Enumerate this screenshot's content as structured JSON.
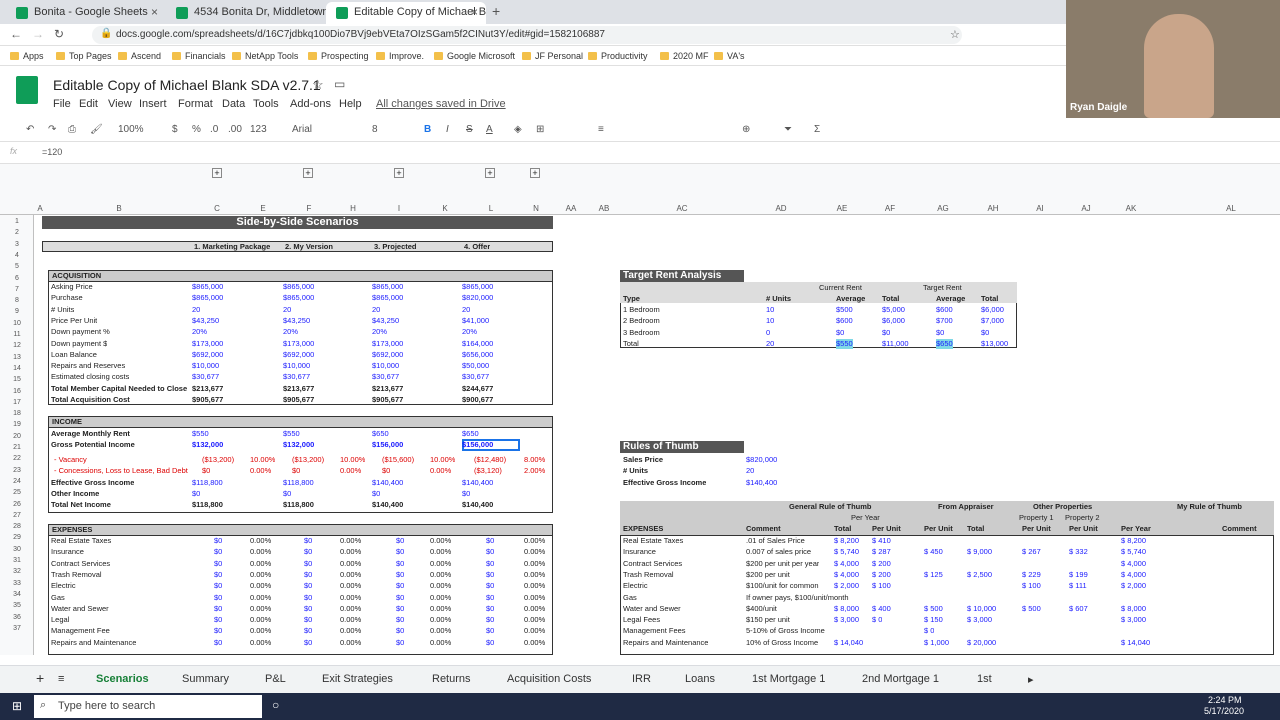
{
  "browser": {
    "tabs": [
      {
        "label": "Bonita - Google Sheets",
        "active": false
      },
      {
        "label": "4534 Bonita Dr, Middletown - Yo",
        "active": false
      },
      {
        "label": "Editable Copy of Michael Blank S",
        "active": true
      }
    ],
    "url": "docs.google.com/spreadsheets/d/16C7jdbkq100Dio7BVj9ebVEta7OIzSGam5f2CINut3Y/edit#gid=1582106887"
  },
  "bookmarks": [
    "Apps",
    "Top Pages",
    "Ascend",
    "Financials",
    "NetApp Tools",
    "Prospecting",
    "Improve.",
    "Google Microsoft",
    "JF Personal",
    "Productivity",
    "2020 MF",
    "VA's"
  ],
  "doc": {
    "title": "Editable Copy of Michael Blank SDA v2.7.1",
    "saved": "All changes saved in Drive",
    "menu": [
      "File",
      "Edit",
      "View",
      "Insert",
      "Format",
      "Data",
      "Tools",
      "Add-ons",
      "Help"
    ]
  },
  "toolbar": {
    "zoom": "100%",
    "currency": "$",
    "percent": "%",
    "dec1": ".0",
    "dec2": ".00",
    "fmt": "123",
    "font": "Arial",
    "size": "8"
  },
  "formula": "=120",
  "webcam_name": "Ryan Daigle",
  "columns": [
    "A",
    "B",
    "C",
    "E",
    "F",
    "H",
    "I",
    "K",
    "L",
    "N",
    "AA",
    "AB",
    "AC",
    "AD",
    "AE",
    "AF",
    "AG",
    "AH",
    "AI",
    "AJ",
    "AK",
    "AL"
  ],
  "rows": [
    "1",
    "2",
    "3",
    "4",
    "5",
    "6",
    "7",
    "8",
    "9",
    "10",
    "11",
    "12",
    "13",
    "14",
    "15",
    "16",
    "17",
    "18",
    "19",
    "20",
    "21",
    "22",
    "23",
    "24",
    "25",
    "26",
    "27",
    "28",
    "29",
    "30",
    "31",
    "32",
    "33",
    "34",
    "35",
    "36",
    "37"
  ],
  "scen": {
    "title": "Side-by-Side Scenarios",
    "heads": [
      "1. Marketing Package",
      "2. My Version",
      "3. Projected",
      "4. Offer"
    ],
    "acq_label": "ACQUISITION",
    "acq": [
      [
        "Asking Price",
        "$865,000",
        "$865,000",
        "$865,000",
        "$865,000"
      ],
      [
        "Purchase",
        "$865,000",
        "$865,000",
        "$865,000",
        "$820,000"
      ],
      [
        "# Units",
        "20",
        "20",
        "20",
        "20"
      ],
      [
        "Price Per Unit",
        "$43,250",
        "$43,250",
        "$43,250",
        "$41,000"
      ],
      [
        "Down payment %",
        "20%",
        "20%",
        "20%",
        "20%"
      ],
      [
        "Down payment $",
        "$173,000",
        "$173,000",
        "$173,000",
        "$164,000"
      ],
      [
        "Loan Balance",
        "$692,000",
        "$692,000",
        "$692,000",
        "$656,000"
      ],
      [
        "Repairs and Reserves",
        "$10,000",
        "$10,000",
        "$10,000",
        "$50,000"
      ],
      [
        "Estimated closing costs",
        "$30,677",
        "$30,677",
        "$30,677",
        "$30,677"
      ],
      [
        "Total Member Capital Needed to Close",
        "$213,677",
        "$213,677",
        "$213,677",
        "$244,677"
      ],
      [
        "Total Acquisition Cost",
        "$905,677",
        "$905,677",
        "$905,677",
        "$900,677"
      ]
    ],
    "inc_label": "INCOME",
    "amr": [
      "Average Monthly Rent",
      "$550",
      "$550",
      "$650",
      "$650"
    ],
    "gpi": [
      "Gross Potential Income",
      "$132,000",
      "$132,000",
      "$156,000",
      "$156,000"
    ],
    "vac": [
      "- Vacancy",
      "($13,200)",
      "10.00%",
      "($13,200)",
      "10.00%",
      "($15,600)",
      "10.00%",
      "($12,480)",
      "8.00%"
    ],
    "con": [
      "- Concessions, Loss to Lease, Bad Debt",
      "$0",
      "0.00%",
      "$0",
      "0.00%",
      "$0",
      "0.00%",
      "($3,120)",
      "2.00%"
    ],
    "egi": [
      "Effective Gross Income",
      "$118,800",
      "$118,800",
      "$140,400",
      "$140,400"
    ],
    "oth": [
      "Other Income",
      "$0",
      "$0",
      "$0",
      "$0"
    ],
    "tni": [
      "Total Net Income",
      "$118,800",
      "$118,800",
      "$140,400",
      "$140,400"
    ],
    "exp_label": "EXPENSES",
    "exp": [
      "Real Estate Taxes",
      "Insurance",
      "Contract Services",
      "Trash Removal",
      "Electric",
      "Gas",
      "Water and Sewer",
      "Legal",
      "Management Fee",
      "Repairs and Maintenance"
    ],
    "exp_zero": "$0",
    "exp_pct": "0.00%"
  },
  "tra": {
    "title": "Target Rent Analysis",
    "cur": "Current Rent",
    "tgt": "Target Rent",
    "cols": [
      "Type",
      "# Units",
      "Average",
      "Total",
      "Average",
      "Total"
    ],
    "rows": [
      [
        "1 Bedroom",
        "10",
        "$500",
        "$5,000",
        "$600",
        "$6,000"
      ],
      [
        "2 Bedroom",
        "10",
        "$600",
        "$6,000",
        "$700",
        "$7,000"
      ],
      [
        "3 Bedroom",
        "0",
        "$0",
        "$0",
        "$0",
        "$0"
      ],
      [
        "Total",
        "20",
        "$550",
        "$11,000",
        "$650",
        "$13,000"
      ]
    ]
  },
  "rot": {
    "title": "Rules of Thumb",
    "sp": [
      "Sales Price",
      "$820,000"
    ],
    "un": [
      "# Units",
      "20"
    ],
    "egi": [
      "Effective Gross Income",
      "$140,400"
    ],
    "h1": "General Rule of Thumb",
    "h2": "From Appraiser",
    "h3": "Other Properties",
    "h4": "My Rule of Thumb",
    "peryear": "Per Year",
    "p1": "Property 1",
    "p2": "Property 2",
    "sub": [
      "EXPENSES",
      "Comment",
      "Total",
      "Per Unit",
      "Per Unit",
      "Total",
      "Per Unit",
      "Per Unit",
      "Per Year",
      "Comment"
    ],
    "rows": [
      [
        "Real Estate Taxes",
        ".01 of Sales Price",
        "$ 8,200",
        "$ 410",
        "",
        "",
        "",
        "",
        "$ 8,200"
      ],
      [
        "Insurance",
        "0.007 of sales price",
        "$ 5,740",
        "$ 287",
        "$ 450",
        "$ 9,000",
        "$ 267",
        "$ 332",
        "$ 5,740"
      ],
      [
        "Contract Services",
        "$200 per unit per year",
        "$ 4,000",
        "$ 200",
        "",
        "",
        "",
        "",
        "$ 4,000"
      ],
      [
        "Trash Removal",
        "$200 per unit",
        "$ 4,000",
        "$ 200",
        "$ 125",
        "$ 2,500",
        "$ 229",
        "$ 199",
        "$ 4,000"
      ],
      [
        "Electric",
        "$100/unit for common",
        "$ 2,000",
        "$ 100",
        "",
        "",
        "$ 100",
        "$ 111",
        "$ 2,000"
      ],
      [
        "Gas",
        "If owner pays, $100/unit/month",
        "",
        "",
        "",
        "",
        "",
        "",
        ""
      ],
      [
        "Water and Sewer",
        "$400/unit",
        "$ 8,000",
        "$ 400",
        "$ 500",
        "$ 10,000",
        "$ 500",
        "$ 607",
        "$ 8,000"
      ],
      [
        "Legal Fees",
        "$150 per unit",
        "$ 3,000",
        "$ 0",
        "$ 150",
        "$ 3,000",
        "",
        "",
        "$ 3,000"
      ],
      [
        "Management Fees",
        "5-10% of Gross Income",
        "",
        "",
        "$ 0",
        "",
        "",
        "",
        ""
      ],
      [
        "Repairs and Maintenance",
        "10% of Gross Income",
        "$ 14,040",
        "",
        "$ 1,000",
        "$ 20,000",
        "",
        "",
        "$ 14,040"
      ]
    ]
  },
  "sheets": [
    "Scenarios",
    "Summary",
    "P&L",
    "Exit Strategies",
    "Returns",
    "Acquisition Costs",
    "IRR",
    "Loans",
    "1st Mortgage 1",
    "2nd Mortgage 1",
    "1st"
  ],
  "taskbar": {
    "search": "Type here to search",
    "time": "2:24 PM",
    "date": "5/17/2020"
  }
}
